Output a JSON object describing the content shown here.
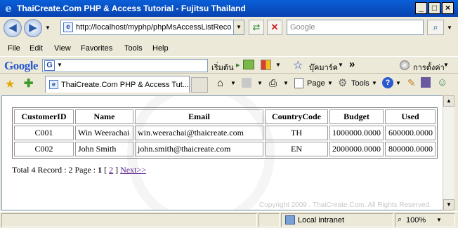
{
  "window": {
    "title": "ThaiCreate.Com PHP & Access Tutorial - Fujitsu Thailand"
  },
  "address": {
    "url": "http://localhost/myphp/phpMsAccessListRecord"
  },
  "search": {
    "placeholder": "Google"
  },
  "menu": [
    "File",
    "Edit",
    "View",
    "Favorites",
    "Tools",
    "Help"
  ],
  "google_bar": {
    "logo": "Google",
    "start_label": "เริ่มต้น",
    "bookmarks_label": "บุ๊คมาร์ค",
    "more": "»",
    "settings_label": "การตั้งค่า"
  },
  "tab": {
    "title": "ThaiCreate.Com PHP & Access Tut..."
  },
  "toolbar": {
    "page_label": "Page",
    "tools_label": "Tools"
  },
  "table": {
    "headers": [
      "CustomerID",
      "Name",
      "Email",
      "CountryCode",
      "Budget",
      "Used"
    ],
    "rows": [
      [
        "C001",
        "Win Weerachai",
        "win.weerachai@thaicreate.com",
        "TH",
        "1000000.0000",
        "600000.0000"
      ],
      [
        "C002",
        "John Smith",
        "john.smith@thaicreate.com",
        "EN",
        "2000000.0000",
        "800000.0000"
      ]
    ]
  },
  "pager": {
    "summary": "Total 4 Record : 2 Page :",
    "current": "1",
    "open_bracket": "[",
    "page2": "2",
    "close_bracket": "]",
    "next": "Next>>"
  },
  "footer": {
    "copyright": "Copyright 2009 . ThaiCreate.Com. All Rights Reserved."
  },
  "status": {
    "zone": "Local intranet",
    "zoom": "100%"
  }
}
